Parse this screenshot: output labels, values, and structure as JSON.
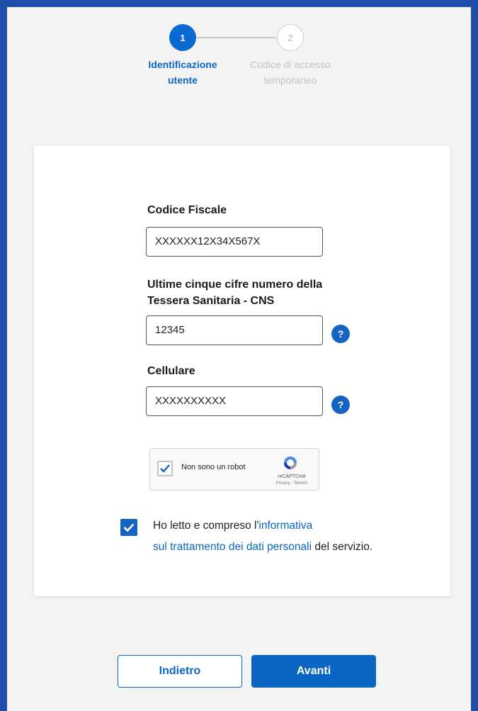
{
  "stepper": {
    "step1_number": "1",
    "step1_label_line1": "Identificazione",
    "step1_label_line2": "utente",
    "step2_number": "2",
    "step2_label_line1": "Codice di accesso",
    "step2_label_line2": "temporaneo"
  },
  "form": {
    "codice_fiscale_label": "Codice Fiscale",
    "codice_fiscale_value": "XXXXXX12X34X567X",
    "tessera_label_line1": "Ultime cinque cifre numero della",
    "tessera_label_line2": "Tessera Sanitaria - CNS",
    "tessera_value": "12345",
    "cellulare_label": "Cellulare",
    "cellulare_value": "XXXXXXXXXX",
    "help_symbol": "?"
  },
  "recaptcha": {
    "label": "Non sono un robot",
    "brand": "reCAPTCHA",
    "terms": "Privacy - Termini",
    "checked": true
  },
  "consent": {
    "text_before": "Ho letto e compreso l'",
    "link_part1": "informativa",
    "link_part2": "sul trattamento dei dati personali",
    "text_after": " del servizio.",
    "checked": true
  },
  "buttons": {
    "back_label": "Indietro",
    "next_label": "Avanti"
  },
  "colors": {
    "primary": "#0a66c2",
    "frame": "#1f4fa8",
    "inactive": "#c3c3c3"
  }
}
